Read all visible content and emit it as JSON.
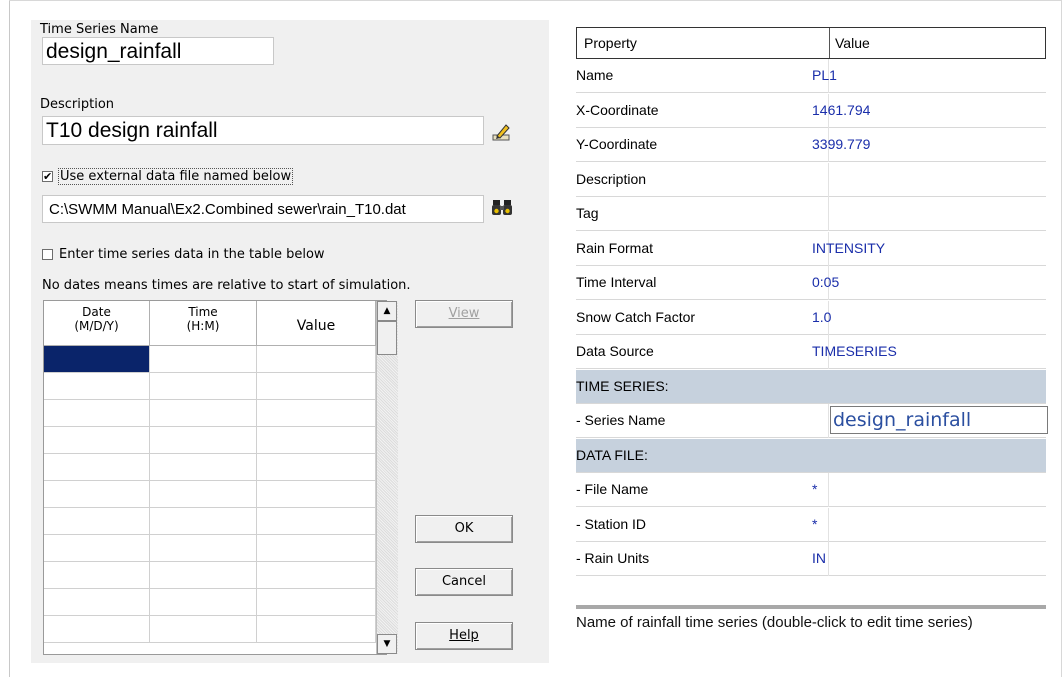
{
  "ts_dialog": {
    "name_label": "Time Series Name",
    "name_value": "design_rainfall",
    "desc_label": "Description",
    "desc_value": "T10 design rainfall",
    "use_file_label": "Use external data file named below",
    "use_file_checked": true,
    "file_path": "C:\\SWMM Manual\\Ex2.Combined sewer\\rain_T10.dat",
    "enter_table_label": "Enter time series data in the table below",
    "enter_table_checked": false,
    "note": "No dates means times are relative to start of simulation.",
    "columns": [
      {
        "line1": "Date",
        "line2": "(M/D/Y)"
      },
      {
        "line1": "Time",
        "line2": "(H:M)"
      },
      {
        "line1": "",
        "line2": "Value"
      }
    ],
    "view_label": "View",
    "ok_label": "OK",
    "cancel_label": "Cancel",
    "help_label": "Help"
  },
  "properties": {
    "header_property": "Property",
    "header_value": "Value",
    "rows": [
      {
        "key": "Name",
        "value": "PL1"
      },
      {
        "key": "X-Coordinate",
        "value": "1461.794"
      },
      {
        "key": "Y-Coordinate",
        "value": "3399.779"
      },
      {
        "key": "Description",
        "value": ""
      },
      {
        "key": "Tag",
        "value": ""
      },
      {
        "key": "Rain Format",
        "value": "INTENSITY"
      },
      {
        "key": "Time Interval",
        "value": "0:05"
      },
      {
        "key": "Snow Catch Factor",
        "value": "1.0"
      },
      {
        "key": "Data Source",
        "value": "TIMESERIES"
      },
      {
        "key": "TIME SERIES:",
        "value": ""
      },
      {
        "key": "- Series Name",
        "value": "design_rainfall"
      },
      {
        "key": "DATA FILE:",
        "value": ""
      },
      {
        "key": "- File Name",
        "value": "*"
      },
      {
        "key": "- Station ID",
        "value": "*"
      },
      {
        "key": "- Rain Units",
        "value": "IN"
      }
    ],
    "hint": "Name of rainfall time series (double-click to edit time series)"
  },
  "icons": {
    "desc_edit": "edit-pencil-icon",
    "browse": "binoculars-icon"
  },
  "colors": {
    "value_text": "#1a2eaa",
    "section_bg": "#c6d1dd",
    "selected_cell": "#0a246a"
  }
}
